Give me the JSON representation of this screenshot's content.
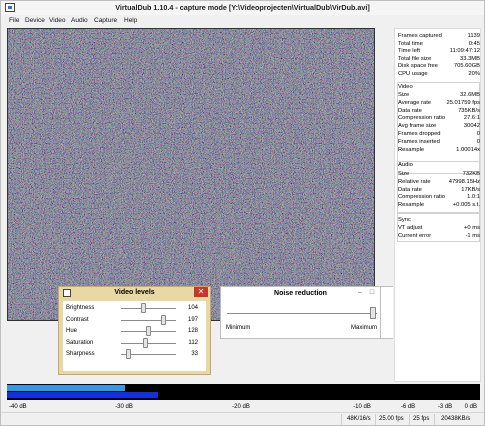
{
  "window": {
    "title": "VirtualDub 1.10.4 - capture mode [Y:\\Videoprojecten\\VirtualDub\\VirDub.avi]"
  },
  "menu": [
    "File",
    "Device",
    "Video",
    "Audio",
    "Capture",
    "Help"
  ],
  "stats": {
    "top": [
      {
        "k": "Frames captured",
        "v": "1139"
      },
      {
        "k": "Total time",
        "v": "0:45"
      },
      {
        "k": "Time left",
        "v": "11:09:47:12"
      },
      {
        "k": "Total file size",
        "v": "33.3MB"
      },
      {
        "k": "Disk space free",
        "v": "705.60GB"
      },
      {
        "k": "CPU usage",
        "v": "20%"
      }
    ],
    "video": {
      "title": "Video",
      "rows": [
        {
          "k": "Size",
          "v": "32.6MB"
        },
        {
          "k": "Average rate",
          "v": "25.01759 fps"
        },
        {
          "k": "Data rate",
          "v": "735KB/s"
        },
        {
          "k": "Compression ratio",
          "v": "27.6:1"
        },
        {
          "k": "Avg frame size",
          "v": "30042"
        },
        {
          "k": "Frames dropped",
          "v": "0"
        },
        {
          "k": "Frames inserted",
          "v": "0"
        },
        {
          "k": "Resample",
          "v": "1.00014x"
        }
      ]
    },
    "audio": {
      "title": "Audio",
      "rows": [
        {
          "k": "Size",
          "v": "732KB"
        },
        {
          "k": "Relative rate",
          "v": "47998.15Hz"
        },
        {
          "k": "Data rate",
          "v": "17KB/s"
        },
        {
          "k": "Compression ratio",
          "v": "1.0:1"
        },
        {
          "k": "Resample",
          "v": "+0.005 s.t."
        }
      ]
    },
    "sync": {
      "title": "Sync",
      "rows": [
        {
          "k": "VT adjust",
          "v": "+0 ms"
        },
        {
          "k": "Current error",
          "v": "-1 ms"
        }
      ]
    }
  },
  "audio_meter": {
    "channel1_level_fraction": 0.25,
    "channel2_level_fraction": 0.32,
    "colors": {
      "ch1": "#2f9ae6",
      "ch2": "#1130e2"
    },
    "scale": [
      "-40 dB",
      "-30 dB",
      "-20 dB",
      "-10 dB",
      "-6 dB",
      "-3 dB",
      "0 dB"
    ]
  },
  "statusbar": [
    "48K/16/s",
    "25.00 fps",
    "25 fps",
    "20438KB/s"
  ],
  "video_levels": {
    "title": "Video levels",
    "close": "✕",
    "rows": [
      {
        "label": "Brightness",
        "value": "104",
        "fraction": 0.41
      },
      {
        "label": "Contrast",
        "value": "197",
        "fraction": 0.77
      },
      {
        "label": "Hue",
        "value": "128",
        "fraction": 0.5
      },
      {
        "label": "Saturation",
        "value": "112",
        "fraction": 0.44
      },
      {
        "label": "Sharpness",
        "value": "33",
        "fraction": 0.13
      }
    ]
  },
  "noise_reduction": {
    "title": "Noise reduction",
    "min_label": "Minimum",
    "max_label": "Maximum",
    "value_fraction": 0.97,
    "buttons": [
      "–",
      "□"
    ]
  }
}
